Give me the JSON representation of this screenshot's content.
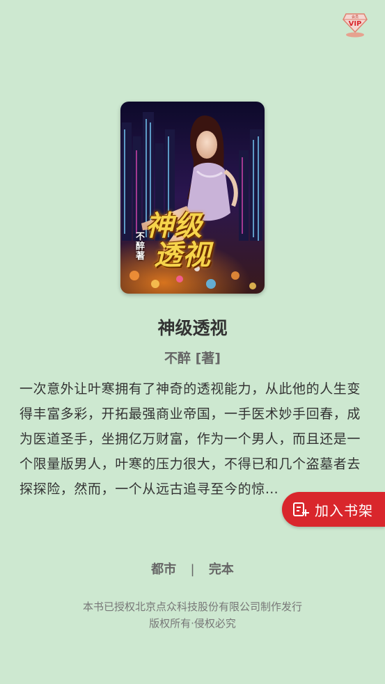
{
  "vip_badge": {
    "icon": "vip-diamond-icon",
    "label": "VIP",
    "sub_label": "会员"
  },
  "book": {
    "cover_title": "神级透视",
    "cover_title_line1": "神级",
    "cover_title_line2": "透视",
    "cover_author_mark": "不醉著",
    "title": "神级透视",
    "author": "不醉 [著]",
    "intro": "一次意外让叶寒拥有了神奇的透视能力，从此他的人生变得丰富多彩，开拓最强商业帝国，一手医术妙手回春，成为医道圣手，坐拥亿万财富，作为一个男人，而且还是一个限量版男人，叶寒的压力很大，不得已和几个盗墓者去探探险，然而，一个从远古追寻至今的惊…",
    "category": "都市",
    "separator": "|",
    "status": "完本"
  },
  "shelf_button": {
    "icon": "add-to-shelf-icon",
    "label": "加入书架"
  },
  "copyright": {
    "line1": "本书已授权北京点众科技股份有限公司制作发行",
    "line2": "版权所有·侵权必究"
  },
  "colors": {
    "background": "#cde8d0",
    "accent": "#d9262c",
    "title_text": "#333333",
    "muted_text": "#666666"
  }
}
